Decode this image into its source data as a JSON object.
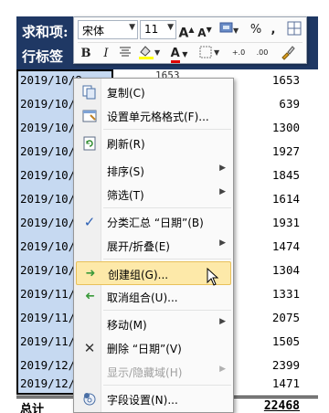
{
  "pivot": {
    "header_sum": "求和项:",
    "header_row_label": "行标签",
    "rows": [
      {
        "date": "2019/10/8",
        "value": "1653",
        "mid": "1653"
      },
      {
        "date": "2019/10/",
        "value": "639",
        "mid": ""
      },
      {
        "date": "2019/10/",
        "value": "1300",
        "mid": ""
      },
      {
        "date": "2019/10/",
        "value": "1927",
        "mid": ""
      },
      {
        "date": "2019/10/",
        "value": "1845",
        "mid": ""
      },
      {
        "date": "2019/10/",
        "value": "1614",
        "mid": ""
      },
      {
        "date": "2019/10/",
        "value": "1931",
        "mid": ""
      },
      {
        "date": "2019/10/",
        "value": "1474",
        "mid": ""
      },
      {
        "date": "2019/10/",
        "value": "1304",
        "mid": ""
      },
      {
        "date": "2019/11/",
        "value": "1331",
        "mid": ""
      },
      {
        "date": "2019/11/",
        "value": "2075",
        "mid": ""
      },
      {
        "date": "2019/11/",
        "value": "1505",
        "mid": ""
      },
      {
        "date": "2019/12/",
        "value": "2399",
        "mid": ""
      },
      {
        "date": "2019/12/",
        "value": "1471",
        "mid": ""
      }
    ],
    "total_label": "总计",
    "total_value": "22468"
  },
  "mini_toolbar": {
    "font_name": "宋体",
    "font_size": "11",
    "grow_font": "A",
    "shrink_font": "A",
    "percent": "%",
    "comma": ",",
    "bold": "B",
    "italic": "I",
    "font_color_letter": "A",
    "increase_decimal": "+.0",
    "decrease_decimal": ".00"
  },
  "context_menu": {
    "items": [
      {
        "label": "复制(C)",
        "icon": "copy-icon",
        "submenu": false,
        "disabled": false
      },
      {
        "label": "设置单元格格式(F)...",
        "icon": "format-cells-icon",
        "submenu": false,
        "disabled": false
      },
      {
        "label": "刷新(R)",
        "icon": "refresh-icon",
        "submenu": false,
        "disabled": false
      },
      {
        "label": "排序(S)",
        "icon": "",
        "submenu": true,
        "disabled": false
      },
      {
        "label": "筛选(T)",
        "icon": "",
        "submenu": true,
        "disabled": false
      },
      {
        "label": "分类汇总 “日期”(B)",
        "icon": "checkmark-icon",
        "submenu": false,
        "disabled": false
      },
      {
        "label": "展开/折叠(E)",
        "icon": "",
        "submenu": true,
        "disabled": false
      },
      {
        "label": "创建组(G)...",
        "icon": "group-arrow-icon",
        "submenu": false,
        "disabled": false
      },
      {
        "label": "取消组合(U)...",
        "icon": "ungroup-arrow-icon",
        "submenu": false,
        "disabled": false
      },
      {
        "label": "移动(M)",
        "icon": "",
        "submenu": true,
        "disabled": false
      },
      {
        "label": "删除 “日期”(V)",
        "icon": "delete-x-icon",
        "submenu": false,
        "disabled": false
      },
      {
        "label": "显示/隐藏域(H)",
        "icon": "",
        "submenu": true,
        "disabled": true
      },
      {
        "label": "字段设置(N)...",
        "icon": "field-settings-icon",
        "submenu": false,
        "disabled": false
      }
    ],
    "highlighted_index": 7
  },
  "colors": {
    "header_bg": "#1f3864",
    "date_col_bg": "#c6d9f1",
    "menu_hover_bg": "#fde9a9",
    "check_color": "#2b5fb4"
  }
}
